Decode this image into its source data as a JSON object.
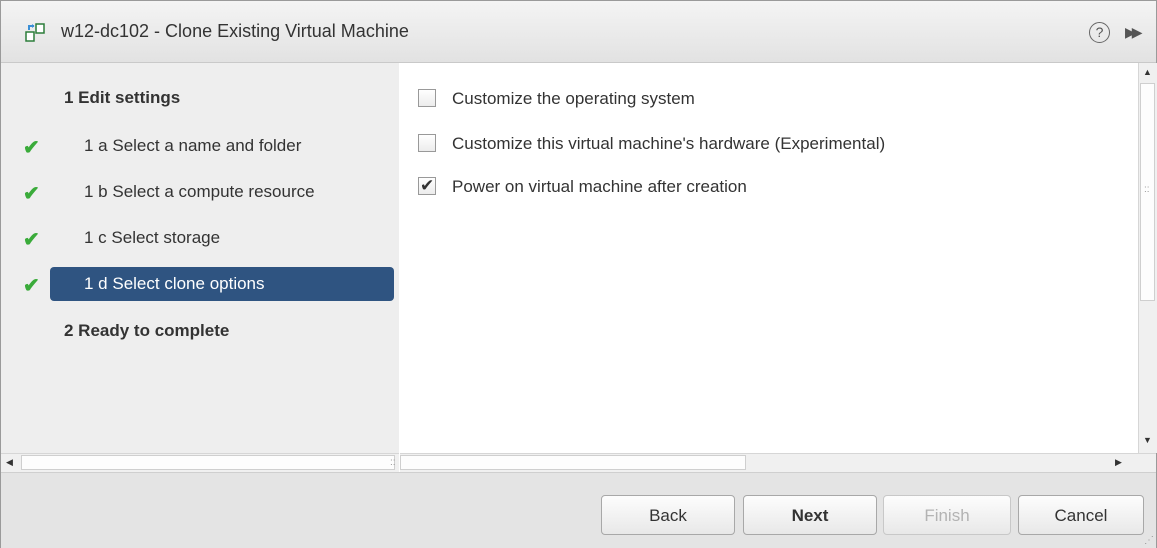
{
  "dialog": {
    "title": "w12-dc102 - Clone Existing Virtual Machine",
    "icons": {
      "title": "clone-vm-icon",
      "help": "help-icon",
      "expand": "expand-icon"
    },
    "help_glyph": "?"
  },
  "nav": {
    "step1_heading": "1 Edit settings",
    "items": [
      {
        "label": "1 a  Select a name and folder",
        "completed": true,
        "selected": false
      },
      {
        "label": "1 b  Select a compute resource",
        "completed": true,
        "selected": false
      },
      {
        "label": "1 c  Select storage",
        "completed": true,
        "selected": false
      },
      {
        "label": "1 d  Select clone options",
        "completed": true,
        "selected": true
      }
    ],
    "step2_heading": "2 Ready to complete"
  },
  "options": [
    {
      "label": "Customize the operating system",
      "checked": false
    },
    {
      "label": "Customize this virtual machine's hardware (Experimental)",
      "checked": false
    },
    {
      "label": "Power on virtual machine after creation",
      "checked": true
    }
  ],
  "buttons": {
    "back": "Back",
    "next": "Next",
    "finish": "Finish",
    "cancel": "Cancel"
  },
  "colors": {
    "selected_bg": "#2f5481",
    "check_green": "#3aab3a",
    "nav_bg": "#eeeeee"
  }
}
